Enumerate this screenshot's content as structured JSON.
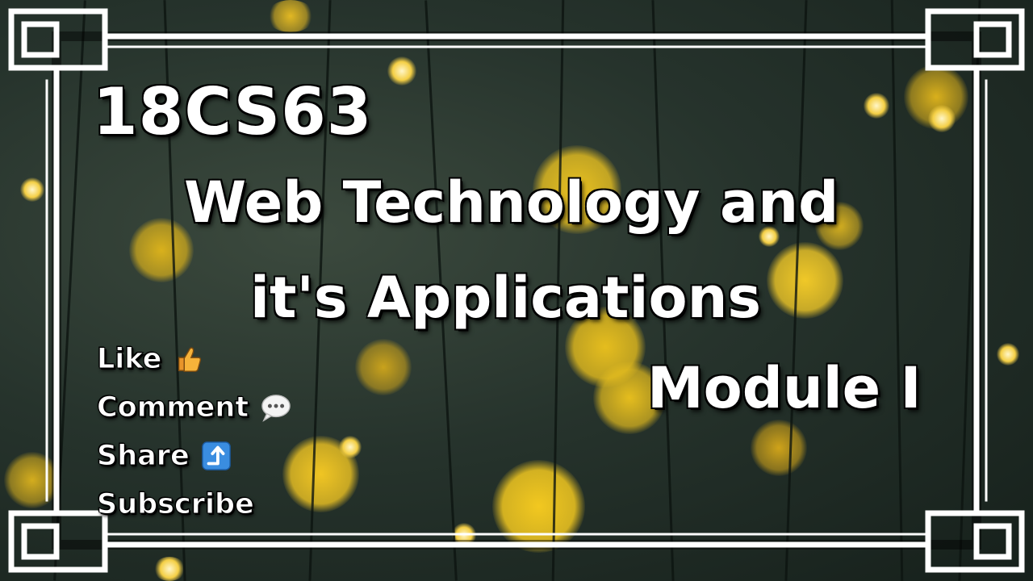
{
  "thumbnail": {
    "course_code": "18CS63",
    "title_line_1": "Web Technology and",
    "title_line_2": "it's Applications",
    "module": "Module I"
  },
  "call_to_action": [
    {
      "label": "Like",
      "icon": "thumbs-up-icon"
    },
    {
      "label": "Comment",
      "icon": "speech-bubble-icon"
    },
    {
      "label": "Share",
      "icon": "share-arrow-icon"
    },
    {
      "label": "Subscribe",
      "icon": null
    }
  ],
  "colors": {
    "text": "#ffffff",
    "text_outline": "#000000",
    "frame": "#ffffff",
    "bokeh": "#f2c21a",
    "background": "#26332c"
  }
}
